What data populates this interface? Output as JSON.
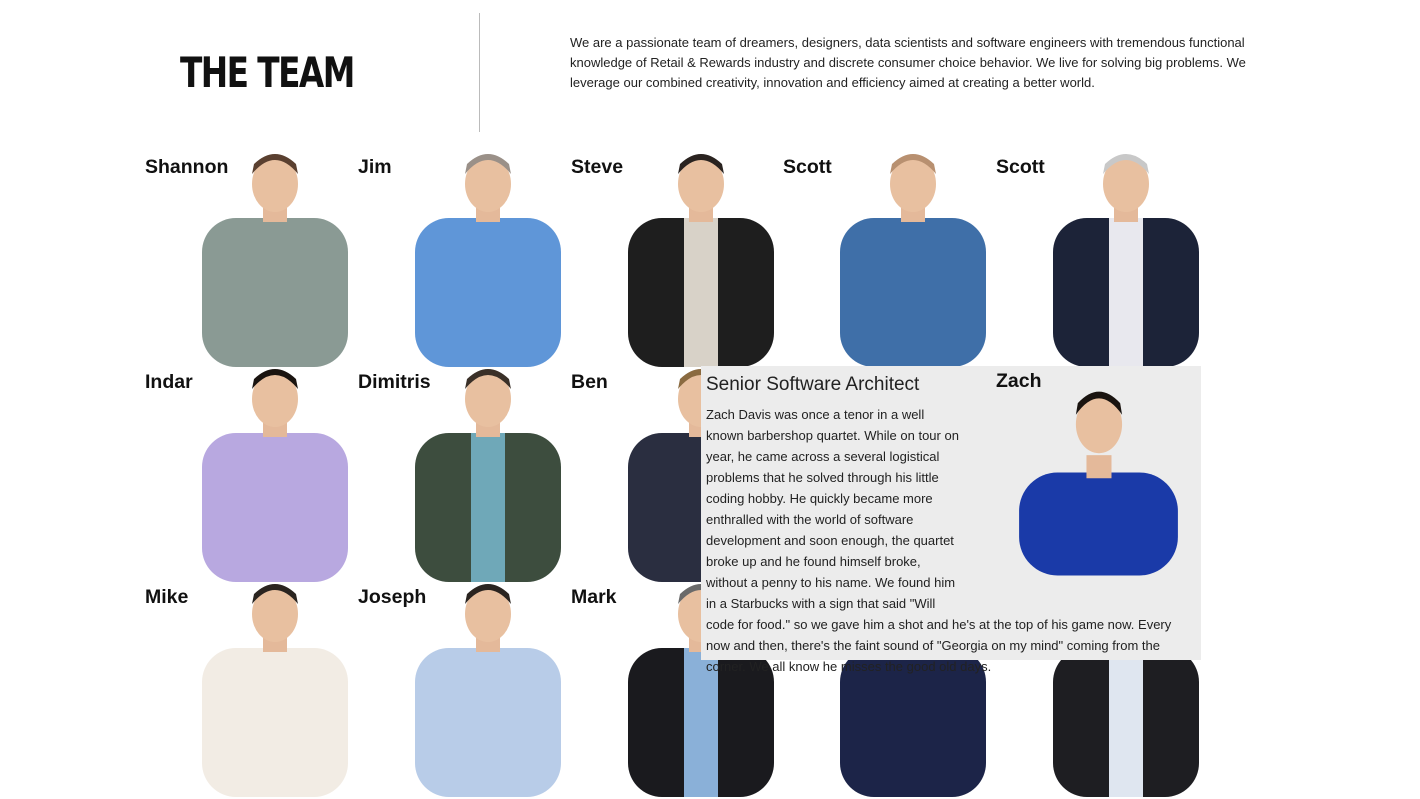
{
  "header": {
    "title": "THE TEAM",
    "intro": "We are a passionate team of dreamers, designers, data scientists and software engineers with tremendous functional knowledge of Retail & Rewards industry and discrete consumer choice behavior. We live for solving big problems. We leverage our combined creativity, innovation and efficiency aimed at creating a better world."
  },
  "team": [
    {
      "name": "Shannon",
      "shirt": "#8a9a94",
      "hair": "#5a4030",
      "jacket": ""
    },
    {
      "name": "Jim",
      "shirt": "#5f96d8",
      "hair": "#9a9088",
      "jacket": ""
    },
    {
      "name": "Steve",
      "shirt": "#d8d2c8",
      "hair": "#2a2320",
      "jacket": "#1e1e1e"
    },
    {
      "name": "Scott",
      "shirt": "#3f6fa8",
      "hair": "#b89070",
      "jacket": ""
    },
    {
      "name": "Scott",
      "shirt": "#e8e8ee",
      "hair": "#c8c8c8",
      "jacket": "#1c2338"
    },
    {
      "name": "Indar",
      "shirt": "#b8a8e0",
      "hair": "#1a1410",
      "jacket": ""
    },
    {
      "name": "Dimitris",
      "shirt": "#6fa8b8",
      "hair": "#3a3028",
      "jacket": "#3d4d3e"
    },
    {
      "name": "Ben",
      "shirt": "#2a2e40",
      "hair": "#8a6a40",
      "jacket": ""
    },
    {
      "name": "Mike",
      "shirt": "#f2ece4",
      "hair": "#2a2420",
      "jacket": ""
    },
    {
      "name": "Joseph",
      "shirt": "#b8cce8",
      "hair": "#2a2420",
      "jacket": ""
    },
    {
      "name": "Mark",
      "shirt": "#8ab0d8",
      "hair": "#6a6a6a",
      "jacket": "#1a1a1e"
    },
    {
      "name": "",
      "shirt": "#1c2448",
      "hair": "#b89060",
      "jacket": ""
    },
    {
      "name": "",
      "shirt": "#dfe6f0",
      "hair": "#2a2420",
      "jacket": "#1e1e22"
    }
  ],
  "featured": {
    "name": "Zach",
    "role": "Senior Software Architect",
    "bio": "Zach Davis was once a tenor in a well known barbershop quartet. While on tour on year, he came across a several logistical problems that he solved through his little coding hobby. He quickly became more enthralled with the world of software development and soon enough, the quartet broke up and he found himself broke, without a penny to his name. We found him in a Starbucks with a sign that said \"Will code for food.\" so we gave him a shot and he's at the top of his game now. Every now and then, there's the faint sound of \"Georgia on my mind\" coming from the corner. We all know he misses the good old days.",
    "shirt": "#1a3aa8",
    "hair": "#1a1410"
  }
}
